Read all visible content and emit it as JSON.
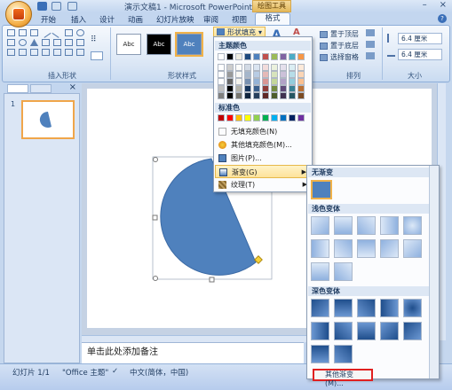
{
  "title_bar": {
    "doc_title": "演示文稿1 - Microsoft PowerPoint",
    "context_label": "绘图工具",
    "win_minimize": "–",
    "win_close": "×"
  },
  "tabs": [
    "开始",
    "插入",
    "设计",
    "动画",
    "幻灯片放映",
    "审阅",
    "视图"
  ],
  "active_tab": "格式",
  "ribbon": {
    "groups": {
      "insert_shapes": "插入形状",
      "shape_styles": "形状样式",
      "arrange": "排列",
      "size": "大小"
    },
    "style_labels": [
      "Abc",
      "Abc",
      "Abc"
    ],
    "shape_fill_button": "形状填充",
    "arrange_buttons": [
      "置于顶层",
      "置于底层",
      "选择窗格"
    ],
    "size": {
      "height": "6.4 厘米",
      "width": "6.4 厘米"
    }
  },
  "fill_menu": {
    "theme_colors_header": "主题颜色",
    "standard_colors_header": "标准色",
    "items": [
      {
        "label": "无填充颜色(N)"
      },
      {
        "label": "其他填充颜色(M)..."
      },
      {
        "label": "图片(P)..."
      },
      {
        "label": "渐变(G)",
        "highlighted": true
      },
      {
        "label": "纹理(T)"
      }
    ],
    "theme_top_row": [
      "#ffffff",
      "#000000",
      "#eeece1",
      "#1f497d",
      "#4f81bd",
      "#c0504d",
      "#9bbb59",
      "#8064a2",
      "#4bacc6",
      "#f79646"
    ],
    "standard_colors": [
      "#c00000",
      "#ff0000",
      "#ffc000",
      "#ffff00",
      "#92d050",
      "#00b050",
      "#00b0f0",
      "#0070c0",
      "#002060",
      "#7030a0"
    ]
  },
  "gradient_menu": {
    "no_gradient_header": "无渐变",
    "light_header": "浅色变体",
    "dark_header": "深色变体",
    "more_label": "其他渐变(M)..."
  },
  "slide_pane": {
    "slide_number": "1"
  },
  "notes_placeholder": "单击此处添加备注",
  "status_bar": {
    "slide_info": "幻灯片 1/1",
    "theme": "\"Office 主题\"",
    "language": "中文(简体，中国)"
  },
  "colors": {
    "shape_fill": "#4f81bd",
    "highlight": "#fde29a",
    "annotation": "#e02020"
  }
}
